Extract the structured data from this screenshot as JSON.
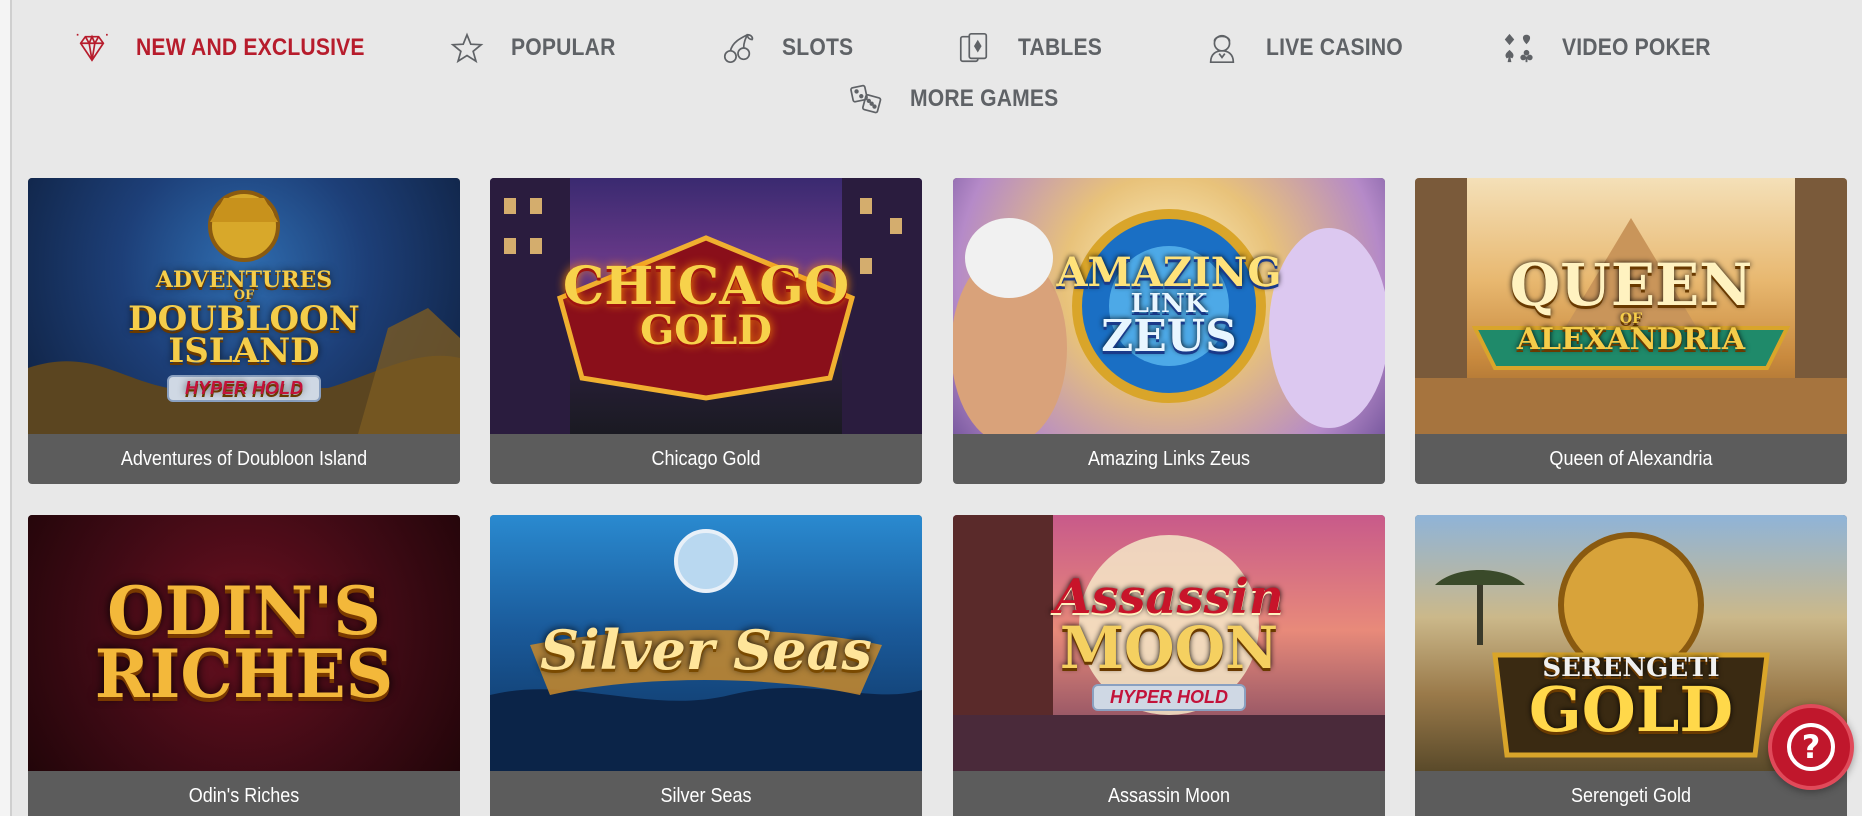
{
  "nav": {
    "items": [
      {
        "label": "NEW AND EXCLUSIVE",
        "icon": "diamond-icon",
        "active": true
      },
      {
        "label": "POPULAR",
        "icon": "star-icon",
        "active": false
      },
      {
        "label": "SLOTS",
        "icon": "cherries-icon",
        "active": false
      },
      {
        "label": "TABLES",
        "icon": "playing-cards-icon",
        "active": false
      },
      {
        "label": "LIVE CASINO",
        "icon": "dealer-icon",
        "active": false
      },
      {
        "label": "VIDEO POKER",
        "icon": "card-suits-icon",
        "active": false
      },
      {
        "label": "MORE GAMES",
        "icon": "dice-icon",
        "active": false
      }
    ]
  },
  "games": [
    {
      "title": "Adventures of Doubloon Island",
      "logo": [
        "ADVENTURES",
        "OF",
        "DOUBLOON",
        "ISLAND"
      ],
      "badge": "HYPER HOLD"
    },
    {
      "title": "Chicago Gold",
      "logo": [
        "CHICAGO",
        "GOLD"
      ],
      "badge": ""
    },
    {
      "title": "Amazing Links Zeus",
      "logo": [
        "AMAZING",
        "LINK",
        "ZEUS"
      ],
      "badge": ""
    },
    {
      "title": "Queen of Alexandria",
      "logo": [
        "QUEEN",
        "OF",
        "ALEXANDRIA"
      ],
      "badge": ""
    },
    {
      "title": "Odin's Riches",
      "logo": [
        "ODIN'S",
        "RICHES"
      ],
      "badge": ""
    },
    {
      "title": "Silver Seas",
      "logo": [
        "Silver Seas"
      ],
      "badge": ""
    },
    {
      "title": "Assassin Moon",
      "logo": [
        "Assassin",
        "MOON"
      ],
      "badge": "HYPER HOLD"
    },
    {
      "title": "Serengeti Gold",
      "logo": [
        "SERENGETI",
        "GOLD"
      ],
      "badge": ""
    }
  ],
  "help": {
    "label": "?"
  },
  "colors": {
    "background": "#e8e8e8",
    "nav_text": "#5f6266",
    "nav_active": "#b71c2c",
    "caption_bar": "#5c5c5c",
    "help_button": "#c0172c"
  }
}
